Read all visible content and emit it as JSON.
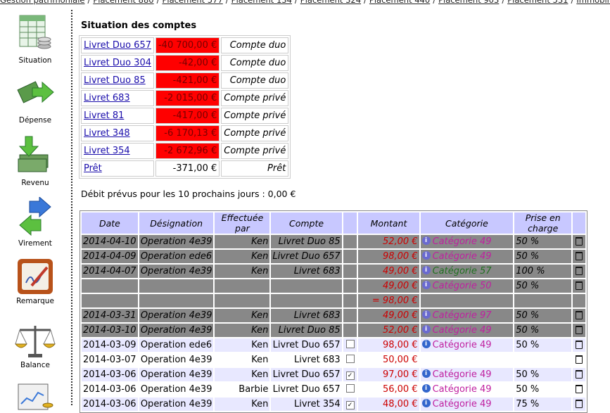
{
  "breadcrumb": [
    "Gestion patrimoniale",
    "Placement 880",
    "Placement 577",
    "Placement 134",
    "Placement 324",
    "Placement 440",
    "Placement 903",
    "Placement 531",
    "Immobilier"
  ],
  "breadcrumb_sep": "/",
  "nav": [
    {
      "label": "Situation",
      "icon": "spreadsheet-coins-icon"
    },
    {
      "label": "Dépense",
      "icon": "money-out-arrow-icon"
    },
    {
      "label": "Revenu",
      "icon": "money-in-arrow-icon"
    },
    {
      "label": "Virement",
      "icon": "transfer-arrows-icon"
    },
    {
      "label": "Remarque",
      "icon": "note-pen-icon"
    },
    {
      "label": "Balance",
      "icon": "scale-icon"
    },
    {
      "label": "",
      "icon": "chart-icon"
    }
  ],
  "accounts_title": "Situation des comptes",
  "accounts": [
    {
      "name": "Livret Duo 657",
      "amount": "-40 700,00 €",
      "type": "Compte duo",
      "negative": true
    },
    {
      "name": "Livret Duo 304",
      "amount": "-42,00 €",
      "type": "Compte duo",
      "negative": true
    },
    {
      "name": "Livret Duo 85",
      "amount": "-421,00 €",
      "type": "Compte duo",
      "negative": true
    },
    {
      "name": "Livret 683",
      "amount": "-2 015,00 €",
      "type": "Compte privé",
      "negative": true
    },
    {
      "name": "Livret 81",
      "amount": "-417,00 €",
      "type": "Compte privé",
      "negative": true
    },
    {
      "name": "Livret 348",
      "amount": "-6 170,13 €",
      "type": "Compte privé",
      "negative": true
    },
    {
      "name": "Livret 354",
      "amount": "-2 672,96 €",
      "type": "Compte privé",
      "negative": true
    },
    {
      "name": "Prêt",
      "amount": "-371,00 €",
      "type": "Prêt",
      "negative": false
    }
  ],
  "debit_text": "Débit prévus pour les 10 prochains jours : 0,00 €",
  "ops_headers": [
    "Date",
    "Désignation",
    "Effectuée par",
    "Compte",
    "",
    "Montant",
    "Catégorie",
    "Prise en charge",
    ""
  ],
  "ops": [
    {
      "kind": "past",
      "date": "2014-04-10",
      "designation": "Operation 4e39",
      "by": "Ken",
      "account": "Livret Duo 85",
      "checked": null,
      "amount": "52,00 €",
      "info": true,
      "category": "Catégorie 49",
      "green": false,
      "share": "50 %",
      "del": true
    },
    {
      "kind": "past",
      "date": "2014-04-09",
      "designation": "Operation ede6",
      "by": "Ken",
      "account": "Livret Duo 657",
      "checked": null,
      "amount": "98,00 €",
      "info": true,
      "category": "Catégorie 49",
      "green": false,
      "share": "50 %",
      "del": true
    },
    {
      "kind": "past",
      "date": "2014-04-07",
      "designation": "Operation 4e39",
      "by": "Ken",
      "account": "Livret 683",
      "checked": null,
      "amount": "49,00 €",
      "info": true,
      "category": "Catégorie 57",
      "green": true,
      "share": "100 %",
      "del": true
    },
    {
      "kind": "past",
      "date": "",
      "designation": "",
      "by": "",
      "account": "",
      "checked": null,
      "amount": "49,00 €",
      "info": true,
      "category": "Catégorie 50",
      "green": false,
      "share": "50 %",
      "del": true
    },
    {
      "kind": "past",
      "date": "",
      "designation": "",
      "by": "",
      "account": "",
      "checked": null,
      "amount": "= 98,00 €",
      "info": false,
      "category": "",
      "green": false,
      "share": "",
      "del": false
    },
    {
      "kind": "past",
      "date": "2014-03-31",
      "designation": "Operation 4e39",
      "by": "Ken",
      "account": "Livret 683",
      "checked": null,
      "amount": "49,00 €",
      "info": true,
      "category": "Catégorie 97",
      "green": false,
      "share": "50 %",
      "del": true
    },
    {
      "kind": "past",
      "date": "2014-03-10",
      "designation": "Operation 4e39",
      "by": "Ken",
      "account": "Livret Duo 85",
      "checked": null,
      "amount": "52,00 €",
      "info": true,
      "category": "Catégorie 49",
      "green": false,
      "share": "50 %",
      "del": true
    },
    {
      "kind": "future",
      "date": "2014-03-09",
      "designation": "Operation ede6",
      "by": "Ken",
      "account": "Livret Duo 657",
      "checked": false,
      "amount": "98,00 €",
      "info": true,
      "category": "Catégorie 49",
      "green": false,
      "share": "50 %",
      "del": true
    },
    {
      "kind": "future alt",
      "date": "2014-03-07",
      "designation": "Operation 4e39",
      "by": "Ken",
      "account": "Livret 683",
      "checked": false,
      "amount": "50,00 €",
      "info": false,
      "category": "",
      "green": false,
      "share": "",
      "del": true
    },
    {
      "kind": "future",
      "date": "2014-03-06",
      "designation": "Operation 4e39",
      "by": "Ken",
      "account": "Livret Duo 657",
      "checked": true,
      "amount": "97,00 €",
      "info": true,
      "category": "Catégorie 49",
      "green": false,
      "share": "50 %",
      "del": true
    },
    {
      "kind": "future alt",
      "date": "2014-03-06",
      "designation": "Operation 4e39",
      "by": "Barbie",
      "account": "Livret Duo 657",
      "checked": false,
      "amount": "56,00 €",
      "info": true,
      "category": "Catégorie 49",
      "green": false,
      "share": "50 %",
      "del": true
    },
    {
      "kind": "future",
      "date": "2014-03-06",
      "designation": "Operation 4e39",
      "by": "Ken",
      "account": "Livret 354",
      "checked": true,
      "amount": "48,00 €",
      "info": true,
      "category": "Catégorie 49",
      "green": false,
      "share": "75 %",
      "del": true
    }
  ],
  "colors": {
    "negative": "#ff0000",
    "header": "#c8c8ff",
    "past_row": "#888888",
    "category": "#c020a0",
    "amount": "#cc0000"
  }
}
